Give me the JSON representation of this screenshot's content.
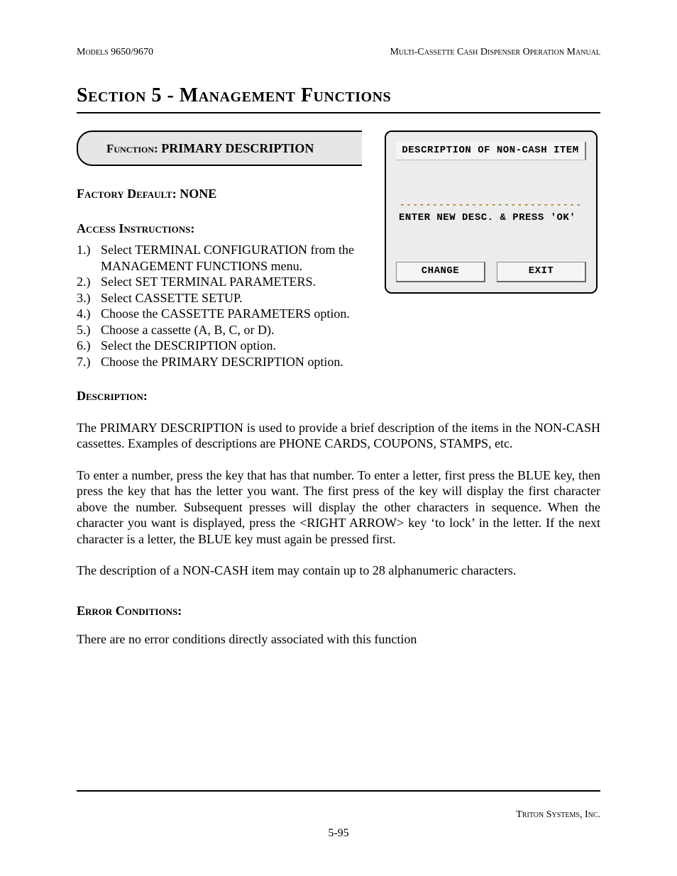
{
  "header": {
    "left": "Models 9650/9670",
    "right": "Multi-Cassette Cash Dispenser Operation Manual"
  },
  "section_title": "Section 5 - Management Functions",
  "function_banner": {
    "label": "Function:",
    "value": "PRIMARY DESCRIPTION"
  },
  "terminal": {
    "title": "DESCRIPTION OF NON-CASH ITEM",
    "dashes": "----------------------------",
    "prompt": "ENTER NEW DESC. & PRESS 'OK'",
    "buttons": {
      "change": "CHANGE",
      "exit": "EXIT"
    }
  },
  "factory_default": {
    "label": "Factory Default:",
    "value": "NONE"
  },
  "access": {
    "label": "Access Instructions:",
    "steps": [
      "Select TERMINAL CONFIGURATION from the MANAGEMENT FUNCTIONS menu.",
      "Select SET TERMINAL PARAMETERS.",
      "Select CASSETTE SETUP.",
      "Choose the CASSETTE PARAMETERS option.",
      "Choose a cassette (A, B, C, or D).",
      "Select the DESCRIPTION option.",
      "Choose the PRIMARY DESCRIPTION option."
    ]
  },
  "description": {
    "label": "Description:",
    "p1": "The PRIMARY DESCRIPTION is used to provide a brief description of the items in the NON-CASH cassettes.  Examples of descriptions are PHONE CARDS, COUPONS, STAMPS, etc.",
    "p2": "To enter a number, press the key that has that number.  To enter a letter, first press the BLUE key, then press the key that has the letter you want.  The first press of the key will display the first character above the number.  Subsequent presses will display the other characters in sequence.  When the character you want is displayed, press the <RIGHT ARROW> key ‘to lock’ in the letter.  If the next character is a letter, the BLUE key must again be pressed first.",
    "p3": "The description of a NON-CASH item may contain up to 28 alphanumeric characters."
  },
  "errors": {
    "label": "Error Conditions:",
    "text": "There are no error conditions directly associated with this function"
  },
  "footer": {
    "company": "Triton Systems, Inc.",
    "page": "5-95"
  }
}
